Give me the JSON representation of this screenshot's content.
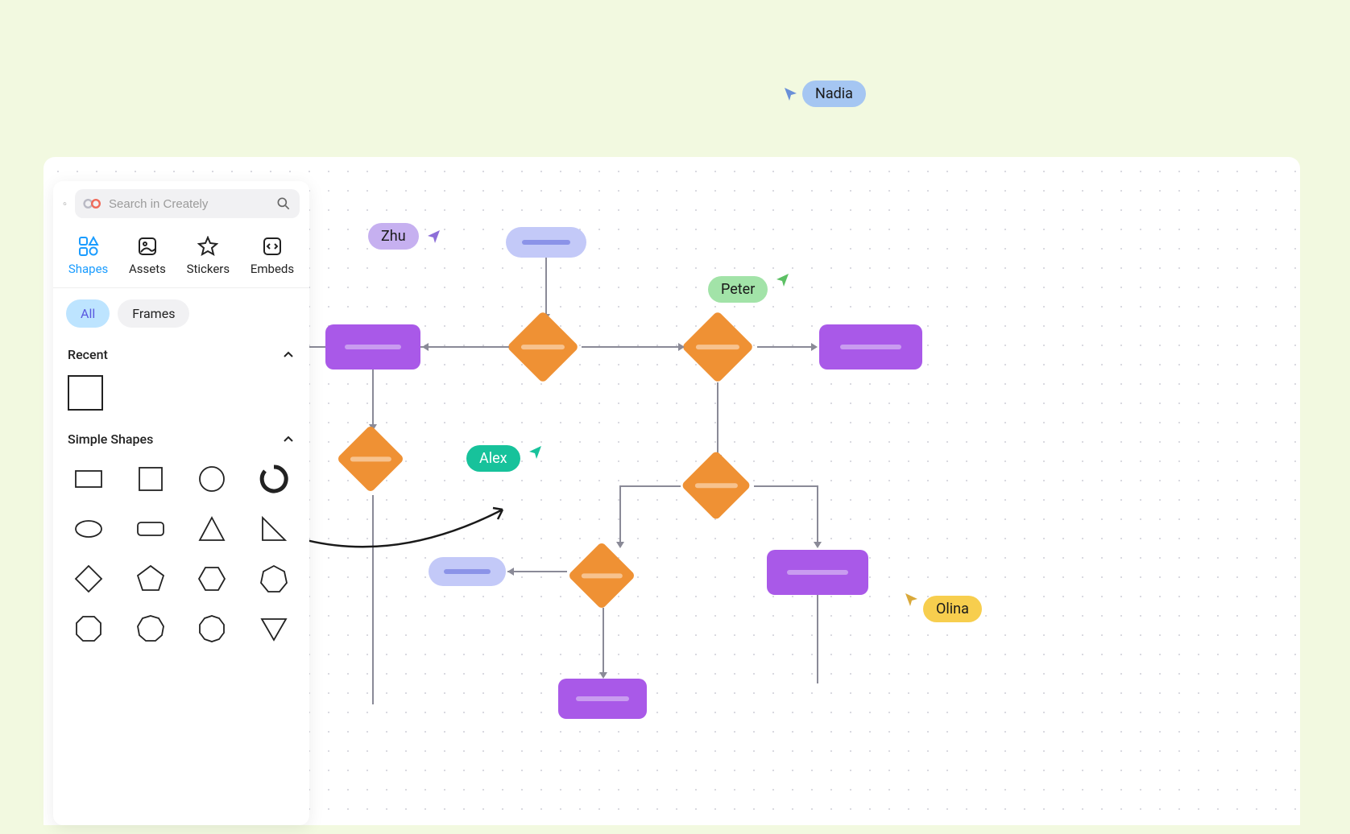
{
  "search": {
    "placeholder": "Search in Creately"
  },
  "tabs": {
    "shapes": "Shapes",
    "assets": "Assets",
    "stickers": "Stickers",
    "embeds": "Embeds"
  },
  "filters": {
    "all": "All",
    "frames": "Frames"
  },
  "sections": {
    "recent": "Recent",
    "simple": "Simple Shapes"
  },
  "collaborators": {
    "nadia": {
      "name": "Nadia",
      "color": "#a5c6f2",
      "cursor_color": "#6a90d8"
    },
    "zhu": {
      "name": "Zhu",
      "color": "#c6b0f0",
      "cursor_color": "#8d6ed8"
    },
    "peter": {
      "name": "Peter",
      "color": "#a2e3a8",
      "cursor_color": "#5cc064"
    },
    "alex": {
      "name": "Alex",
      "color": "#17c29b",
      "cursor_color": "#17c29b"
    },
    "olina": {
      "name": "Olina",
      "color": "#f7ce4e",
      "cursor_color": "#d9a93a"
    }
  },
  "shapes_grid": [
    [
      "rectangle",
      "square",
      "circle",
      "arc"
    ],
    [
      "ellipse",
      "rounded-rectangle",
      "triangle",
      "right-triangle"
    ],
    [
      "diamond",
      "pentagon",
      "hexagon",
      "heptagon"
    ],
    [
      "octagon",
      "nonagon",
      "decagon",
      "triangle-down"
    ]
  ]
}
